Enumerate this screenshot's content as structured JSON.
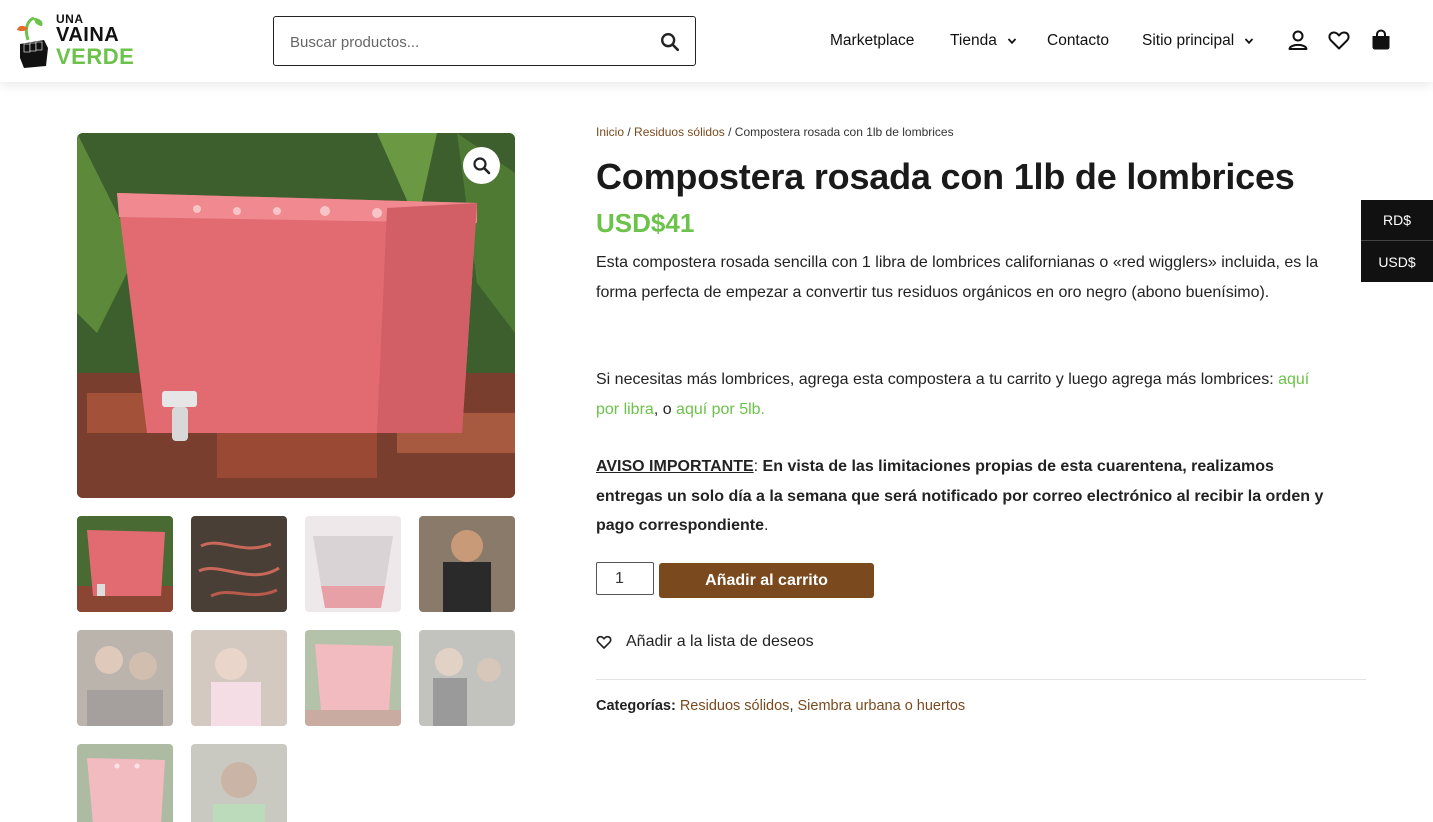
{
  "logo": {
    "line1": "UNA",
    "line2": "VAINA",
    "line3": "VERDE"
  },
  "search": {
    "placeholder": "Buscar productos..."
  },
  "nav": {
    "items": [
      {
        "label": "Marketplace"
      },
      {
        "label": "Tienda"
      },
      {
        "label": "Contacto"
      },
      {
        "label": "Sitio principal"
      }
    ]
  },
  "header_icons": [
    "user-icon",
    "heart-icon",
    "shopping-bag-icon"
  ],
  "breadcrumb": {
    "home": "Inicio",
    "sep": "/",
    "category": "Residuos sólidos",
    "current": "Compostera rosada con 1lb de lombrices"
  },
  "product": {
    "title": "Compostera rosada con 1lb de lombrices",
    "price": "USD$41",
    "desc1": "Esta compostera rosada sencilla con 1 libra de lombrices californianas o «red wigglers» incluida, es la forma perfecta de empezar a convertir tus residuos orgánicos en oro negro (abono buenísimo).",
    "desc2_text": "Si necesitas más lombrices, agrega esta compostera a tu carrito y luego agrega más lombrices: ",
    "desc2_link1": "aquí por libra",
    "desc2_between": ", o ",
    "desc2_link2": "aquí por 5lb.",
    "notice_label": "AVISO IMPORTANTE",
    "notice_colon": ":",
    "notice_text": "En vista de las limitaciones propias de esta cuarentena, realizamos entregas un solo día a la semana que será notificado por correo electrónico al recibir la orden y pago correspondiente",
    "notice_end": ".",
    "quantity": "1",
    "add_to_cart": "Añadir al carrito",
    "wishlist": "Añadir a la lista de deseos",
    "categories_label": "Categorías:",
    "category1": "Residuos sólidos",
    "category_sep": ", ",
    "category2": "Siembra urbana o huertos"
  },
  "currency": {
    "rd": "RD$",
    "usd": "USD$"
  },
  "colors": {
    "accent_green": "#6cc24a",
    "brown": "#7a4a1e",
    "dark": "#111111"
  }
}
